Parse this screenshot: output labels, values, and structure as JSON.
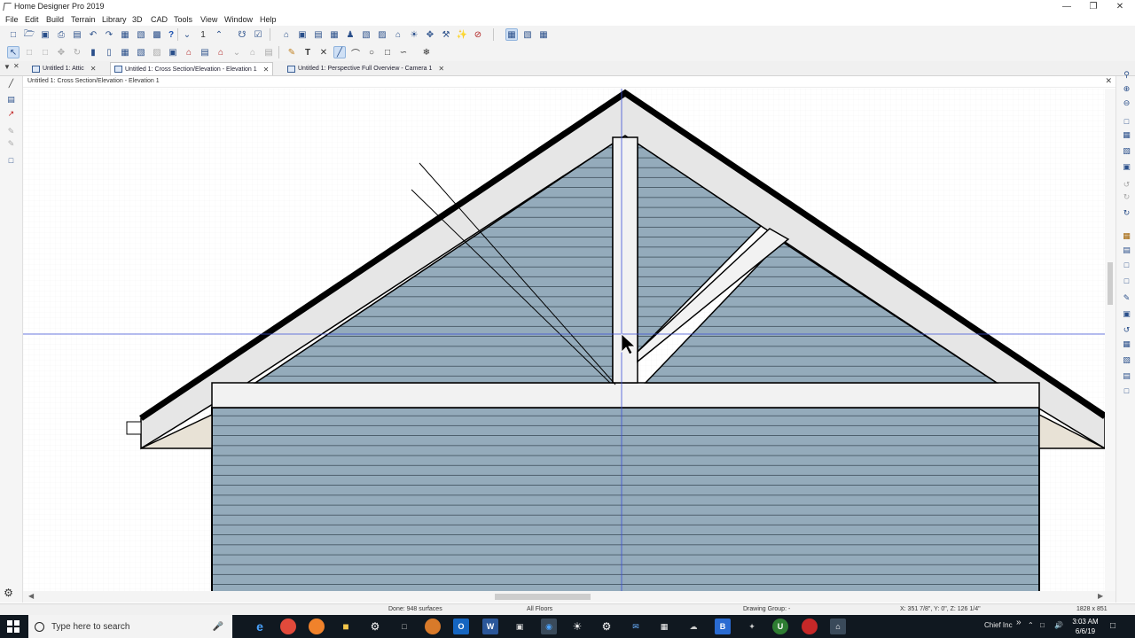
{
  "app": {
    "title": "Home Designer Pro 2019"
  },
  "menu": [
    "File",
    "Edit",
    "Build",
    "Terrain",
    "Library",
    "3D",
    "CAD",
    "Tools",
    "View",
    "Window",
    "Help"
  ],
  "toolbar1": {
    "undo_count": "1"
  },
  "tabs": [
    {
      "label": "Untitled 1: Attic"
    },
    {
      "label": "Untitled 1: Cross Section/Elevation - Elevation 1"
    },
    {
      "label": "Untitled 1: Perspective Full Overview - Camera 1"
    }
  ],
  "view": {
    "header": "Untitled 1: Cross Section/Elevation - Elevation 1"
  },
  "status": {
    "done": "Done: 948 surfaces",
    "floors": "All Floors",
    "drawing_group": "Drawing Group: -",
    "coords": "X: 351 7/8\", Y: 0\", Z: 126 1/4\"",
    "size": "1828 x 851"
  },
  "taskbar": {
    "search_placeholder": "Type here to search",
    "tray_label": "Chief Inc",
    "time": "3:03 AM",
    "date": "6/6/19"
  },
  "colors": {
    "siding": "#94abbb",
    "siding_line": "#2a3a46",
    "trim": "#e6e6e6",
    "roof": "#000000",
    "crosshair": "#3b4fd6"
  }
}
